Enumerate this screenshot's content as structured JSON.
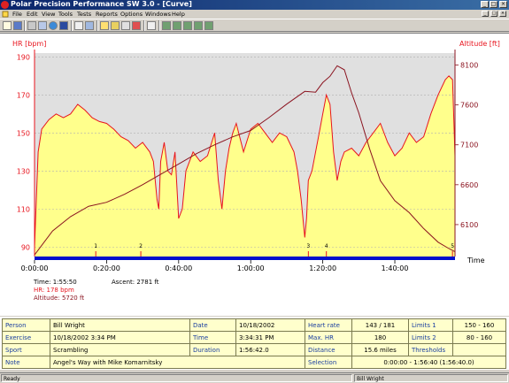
{
  "window": {
    "title": "Polar Precision Performance SW 3.0 - [Curve]",
    "controls": [
      "_",
      "□",
      "×"
    ]
  },
  "menu": {
    "items": [
      "File",
      "Edit",
      "View",
      "Tools",
      "Tests",
      "Reports",
      "Options",
      "Windows",
      "Help"
    ],
    "mdi_controls": [
      "_",
      "□",
      "×"
    ]
  },
  "toolbar": {
    "icons": [
      "new-icon",
      "save-icon",
      "print-icon",
      "copy-icon",
      "globe-icon",
      "calendar-icon",
      "notes-icon",
      "folder-icon",
      "graph-icon",
      "chart-icon",
      "table-icon",
      "bar-chart-icon",
      "delete-icon",
      "report-icon-1",
      "report-icon-2",
      "report-icon-3",
      "report-icon-4",
      "report-icon-5"
    ]
  },
  "colors": {
    "hr_line": "#e8141e",
    "hr_fill": "#ffff8c",
    "altitude_line": "#8b1420",
    "plot_background": "#e0e0e0",
    "time_bar": "#0010cc"
  },
  "chart_data": {
    "type": "line",
    "left_axis_label": "HR [bpm]",
    "right_axis_label": "Altitude [ft]",
    "x_axis_label": "Time",
    "left_ticks": [
      "190",
      "170",
      "150",
      "130",
      "110",
      "90"
    ],
    "right_ticks": [
      "8100",
      "7600",
      "7100",
      "6600",
      "6100"
    ],
    "x_ticks": [
      "0:00:00",
      "0:20:00",
      "0:40:00",
      "1:00:00",
      "1:20:00",
      "1:40:00"
    ],
    "ylim_hr": [
      85,
      192
    ],
    "ylim_alt": [
      5700,
      8250
    ],
    "xlim_min": [
      0,
      116.7
    ],
    "grid": "horizontal dashed lines at HR ticks",
    "lap_markers": [
      {
        "label": "1",
        "t": 17
      },
      {
        "label": "2",
        "t": 29.5
      },
      {
        "label": "3",
        "t": 76
      },
      {
        "label": "4",
        "t": 81
      },
      {
        "label": "5",
        "t": 116
      }
    ],
    "series": [
      {
        "name": "HR",
        "x": [
          0,
          1,
          2,
          4,
          6,
          8,
          10,
          12,
          14,
          16,
          18,
          20,
          22,
          24,
          26,
          28,
          30,
          32,
          33,
          34,
          34.5,
          35,
          36,
          37,
          38,
          39,
          40,
          41,
          42,
          44,
          46,
          48,
          50,
          51,
          52,
          53,
          54,
          55,
          56,
          58,
          60,
          62,
          64,
          66,
          68,
          70,
          72,
          73,
          74,
          75,
          75.5,
          76,
          77,
          78,
          79,
          80,
          81,
          82,
          83,
          84,
          85,
          86,
          88,
          90,
          92,
          94,
          96,
          98,
          100,
          102,
          104,
          106,
          108,
          110,
          112,
          114,
          115,
          116,
          116.7
        ],
        "values": [
          90,
          140,
          152,
          157,
          160,
          158,
          160,
          165,
          162,
          158,
          156,
          155,
          152,
          148,
          146,
          142,
          145,
          140,
          135,
          115,
          110,
          135,
          145,
          130,
          128,
          140,
          105,
          110,
          130,
          140,
          135,
          138,
          150,
          125,
          110,
          130,
          142,
          150,
          155,
          140,
          152,
          155,
          150,
          145,
          150,
          148,
          140,
          130,
          115,
          95,
          105,
          125,
          130,
          140,
          150,
          160,
          170,
          165,
          140,
          125,
          135,
          140,
          142,
          138,
          145,
          150,
          155,
          145,
          138,
          142,
          150,
          145,
          148,
          160,
          170,
          178,
          180,
          178,
          138
        ]
      },
      {
        "name": "Altitude",
        "x": [
          0,
          5,
          10,
          15,
          20,
          25,
          30,
          35,
          40,
          45,
          50,
          55,
          60,
          65,
          70,
          75,
          78,
          80,
          82,
          84,
          86,
          88,
          90,
          93,
          96,
          100,
          104,
          108,
          112,
          115,
          116.7
        ],
        "values": [
          5720,
          6020,
          6200,
          6330,
          6380,
          6480,
          6600,
          6730,
          6860,
          6990,
          7100,
          7200,
          7280,
          7440,
          7610,
          7770,
          7760,
          7880,
          7960,
          8090,
          8040,
          7750,
          7500,
          7050,
          6650,
          6400,
          6250,
          6050,
          5880,
          5800,
          5760
        ]
      }
    ]
  },
  "stats": {
    "time": "Time: 1:55:50",
    "hr": "HR: 178 bpm",
    "altitude": "Altitude: 5720 ft",
    "ascent": "Ascent:    2781 ft"
  },
  "info": {
    "person_label": "Person",
    "person_value": "Bill Wright",
    "date_label": "Date",
    "date_value": "10/18/2002",
    "heart_rate_label": "Heart rate",
    "heart_rate_value": "143 / 181",
    "limits1_label": "Limits 1",
    "limits1_value": "150 - 160",
    "exercise_label": "Exercise",
    "exercise_value": "10/18/2002 3:34 PM",
    "time_label": "Time",
    "time_value": "3:34:31 PM",
    "maxhr_label": "Max. HR",
    "maxhr_value": "180",
    "limits2_label": "Limits 2",
    "limits2_value": "80 - 160",
    "sport_label": "Sport",
    "sport_value": "Scrambling",
    "duration_label": "Duration",
    "duration_value": "1:56:42.0",
    "distance_label": "Distance",
    "distance_value": "15.6 miles",
    "thresholds_label": "Thresholds",
    "thresholds_value": "",
    "note_label": "Note",
    "note_value": "Angel's Way with Mike Komarnitsky",
    "selection_label": "Selection",
    "selection_value": "0:00:00 - 1:56:40 (1:56:40.0)"
  },
  "status": {
    "left": "Ready",
    "user": "Bill Wright"
  }
}
